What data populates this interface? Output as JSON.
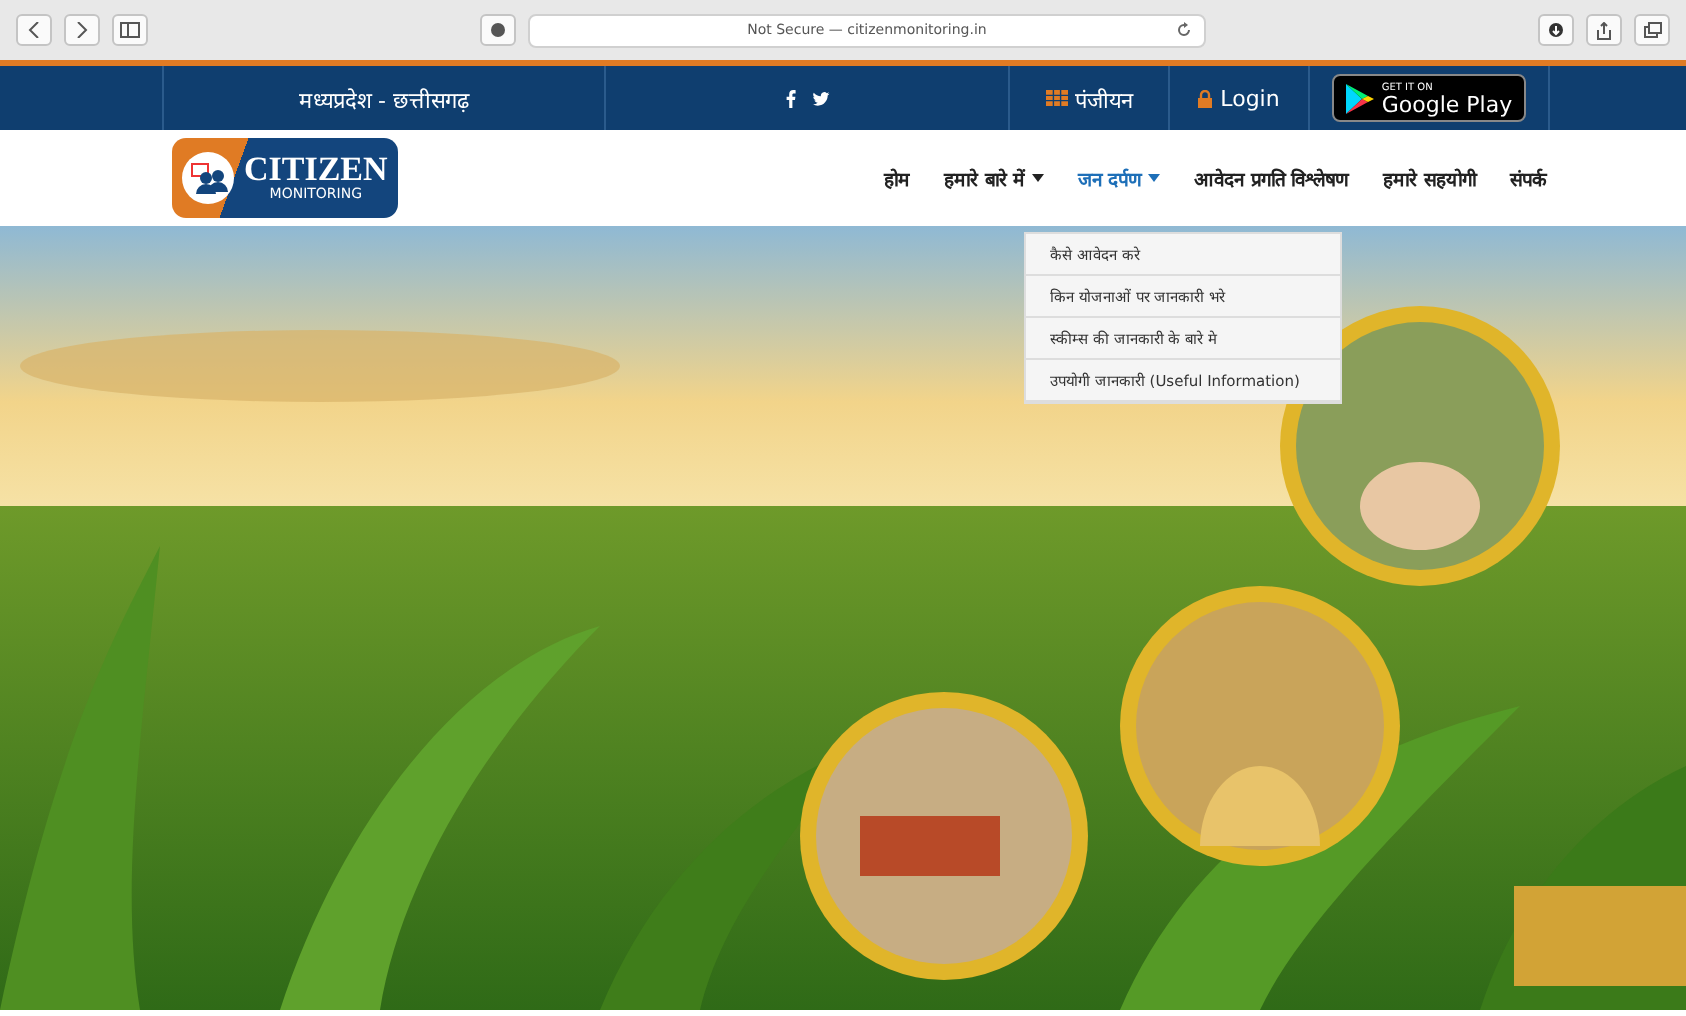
{
  "browser": {
    "address": "Not Secure — citizenmonitoring.in"
  },
  "top_bar": {
    "region": "मध्यप्रदेश - छत्तीसगढ़",
    "register": "पंजीयन",
    "login": "Login",
    "store_badge": {
      "small": "GET IT ON",
      "large": "Google Play"
    }
  },
  "logo": {
    "line1": "CITIZEN",
    "line2": "MONITORING"
  },
  "nav": {
    "items": [
      {
        "label": "होम",
        "caret": false,
        "selected": false
      },
      {
        "label": "हमारे बारे में",
        "caret": true,
        "selected": false
      },
      {
        "label": "जन दर्पण",
        "caret": true,
        "selected": true
      },
      {
        "label": "आवेदन प्रगति विश्लेषण",
        "caret": false,
        "selected": false
      },
      {
        "label": "हमारे सहयोगी",
        "caret": false,
        "selected": false
      },
      {
        "label": "संपर्क",
        "caret": false,
        "selected": false
      }
    ]
  },
  "dropdown": {
    "items": [
      "कैसे आवेदन करे",
      "किन योजनाओं पर जानकारी भरे",
      "स्कीम्स की जानकारी के बारे मे",
      "उपयोगी जानकारी (Useful Information)"
    ]
  }
}
